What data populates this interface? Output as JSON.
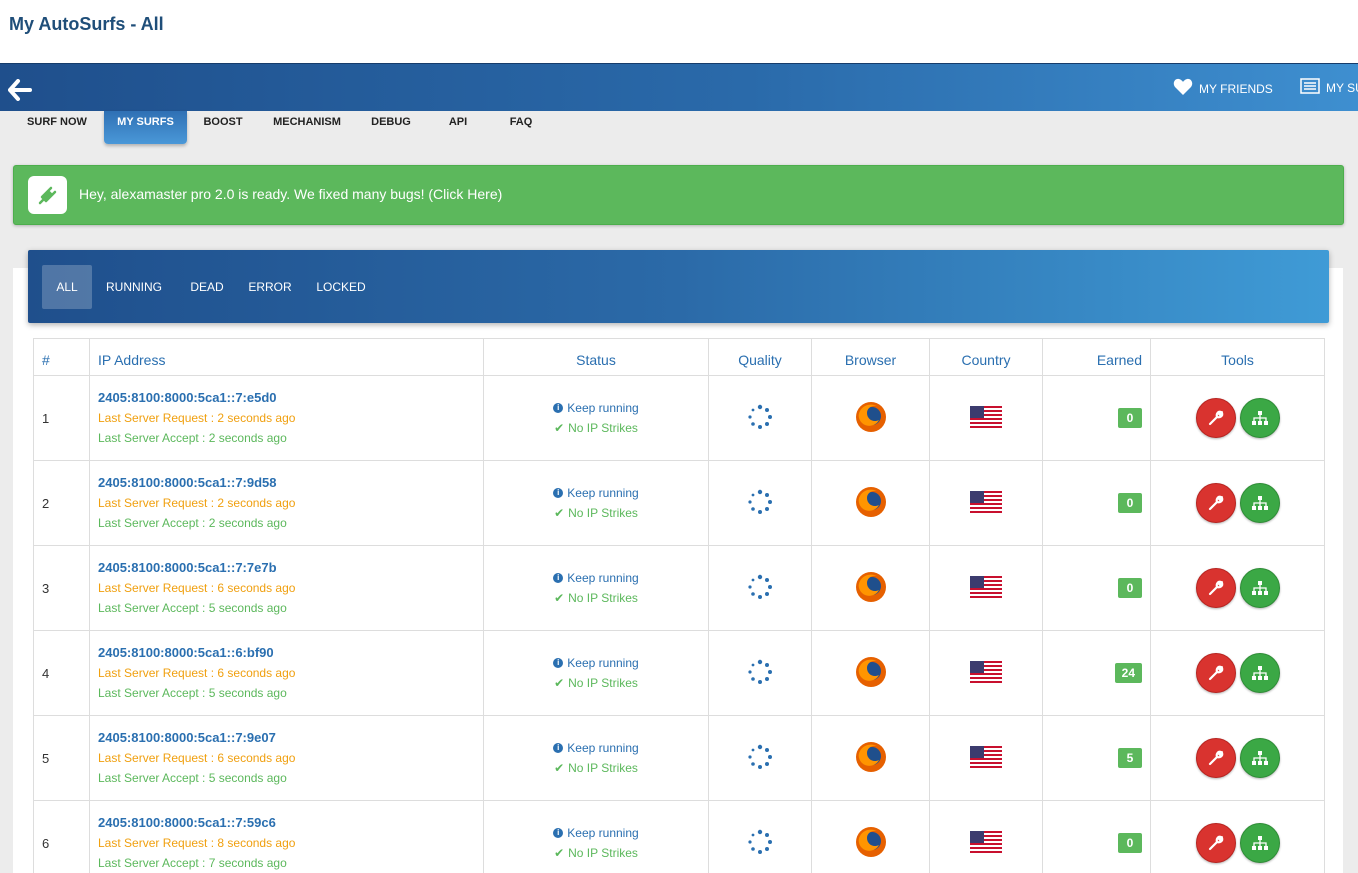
{
  "page": {
    "title": "My AutoSurfs - All"
  },
  "topnav": {
    "back_icon": "arrow-left-icon",
    "links": [
      {
        "label": "MY FRIENDS",
        "icon": "heart-icon"
      },
      {
        "label": "MY SU",
        "icon": "list-icon"
      }
    ]
  },
  "subnav": [
    {
      "label": "SURF NOW",
      "active": false
    },
    {
      "label": "MY SURFS",
      "active": true
    },
    {
      "label": "BOOST",
      "active": false
    },
    {
      "label": "MECHANISM",
      "active": false
    },
    {
      "label": "DEBUG",
      "active": false
    },
    {
      "label": "API",
      "active": false
    },
    {
      "label": "FAQ",
      "active": false
    }
  ],
  "alert": {
    "text": "Hey, alexamaster pro 2.0 is ready. We fixed many bugs! (Click Here)",
    "icon": "plug-icon",
    "color": "#5cb85c"
  },
  "filters": [
    {
      "label": "ALL",
      "active": true
    },
    {
      "label": "RUNNING",
      "active": false
    },
    {
      "label": "DEAD",
      "active": false
    },
    {
      "label": "ERROR",
      "active": false
    },
    {
      "label": "LOCKED",
      "active": false
    }
  ],
  "table": {
    "headers": [
      "#",
      "IP Address",
      "Status",
      "Quality",
      "Browser",
      "Country",
      "Earned",
      "Tools"
    ],
    "rows": [
      {
        "num": "1",
        "ip": "2405:8100:8000:5ca1::7:e5d0",
        "last_request": "Last Server Request : 2 seconds ago",
        "last_accept": "Last Server Accept : 2 seconds ago",
        "status": "Keep running",
        "strikes": "No IP Strikes",
        "browser": "firefox-icon",
        "country": "us-flag-icon",
        "earned": "0"
      },
      {
        "num": "2",
        "ip": "2405:8100:8000:5ca1::7:9d58",
        "last_request": "Last Server Request : 2 seconds ago",
        "last_accept": "Last Server Accept : 2 seconds ago",
        "status": "Keep running",
        "strikes": "No IP Strikes",
        "browser": "firefox-icon",
        "country": "us-flag-icon",
        "earned": "0"
      },
      {
        "num": "3",
        "ip": "2405:8100:8000:5ca1::7:7e7b",
        "last_request": "Last Server Request : 6 seconds ago",
        "last_accept": "Last Server Accept : 5 seconds ago",
        "status": "Keep running",
        "strikes": "No IP Strikes",
        "browser": "firefox-icon",
        "country": "us-flag-icon",
        "earned": "0"
      },
      {
        "num": "4",
        "ip": "2405:8100:8000:5ca1::6:bf90",
        "last_request": "Last Server Request : 6 seconds ago",
        "last_accept": "Last Server Accept : 5 seconds ago",
        "status": "Keep running",
        "strikes": "No IP Strikes",
        "browser": "firefox-icon",
        "country": "us-flag-icon",
        "earned": "24"
      },
      {
        "num": "5",
        "ip": "2405:8100:8000:5ca1::7:9e07",
        "last_request": "Last Server Request : 6 seconds ago",
        "last_accept": "Last Server Accept : 5 seconds ago",
        "status": "Keep running",
        "strikes": "No IP Strikes",
        "browser": "firefox-icon",
        "country": "us-flag-icon",
        "earned": "5"
      },
      {
        "num": "6",
        "ip": "2405:8100:8000:5ca1::7:59c6",
        "last_request": "Last Server Request : 8 seconds ago",
        "last_accept": "Last Server Accept : 7 seconds ago",
        "status": "Keep running",
        "strikes": "No IP Strikes",
        "browser": "firefox-icon",
        "country": "us-flag-icon",
        "earned": "0"
      }
    ]
  },
  "tools": {
    "settings_icon": "wrench-icon",
    "tree_icon": "sitemap-icon"
  },
  "colors": {
    "nav_dark": "#1f4f8c",
    "nav_light": "#3e8fd0",
    "success": "#5cb85c",
    "warning": "#f0a010",
    "danger": "#d9332f",
    "link": "#2a6fb0"
  }
}
